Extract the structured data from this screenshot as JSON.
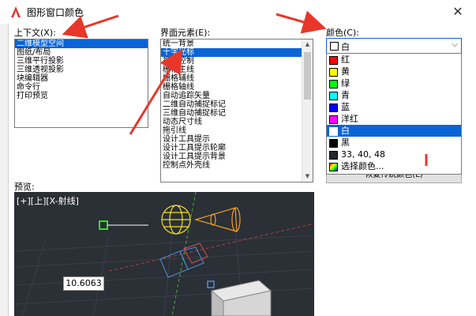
{
  "window": {
    "title": "图形窗口颜色",
    "close_glyph": "✕"
  },
  "context": {
    "label": "上下文(X):",
    "items": [
      "二维模型空间",
      "图纸/布局",
      "三维平行投影",
      "三维透视投影",
      "块编辑器",
      "命令行",
      "打印预览"
    ],
    "selected_index": 0
  },
  "elements": {
    "label": "界面元素(E):",
    "items": [
      "统一背景",
      "十字光标",
      "视口控制",
      "栅格主线",
      "栅格辅线",
      "栅格轴线",
      "自动追踪矢量",
      "二维自动捕捉标记",
      "三维自动捕捉标记",
      "动态尺寸线",
      "拖引线",
      "设计工具提示",
      "设计工具提示轮廓",
      "设计工具提示背景",
      "控制点外壳线"
    ],
    "selected_index": 1
  },
  "color": {
    "label": "颜色(C):",
    "current": "白",
    "options": [
      {
        "label": "红",
        "color": "#ff0000"
      },
      {
        "label": "黄",
        "color": "#ffff00"
      },
      {
        "label": "绿",
        "color": "#00ff00"
      },
      {
        "label": "青",
        "color": "#00ffff"
      },
      {
        "label": "蓝",
        "color": "#0000ff"
      },
      {
        "label": "洋红",
        "color": "#ff00ff"
      },
      {
        "label": "白",
        "color": "#ffffff"
      },
      {
        "label": "黑",
        "color": "#000000"
      },
      {
        "label": "33, 40, 48",
        "color": "#212830"
      },
      {
        "label": "选择颜色...",
        "color": "multi"
      }
    ],
    "selected_index": 6
  },
  "restore_button": "恢复传统颜色(L)",
  "preview": {
    "label": "预览:",
    "viewport_label": "[+][上][X-射线]",
    "dimension_value": "10.6063"
  },
  "colors": {
    "accent": "#0a64d6",
    "arrow": "#e8372a",
    "preview_bg": "#2b2f36"
  }
}
